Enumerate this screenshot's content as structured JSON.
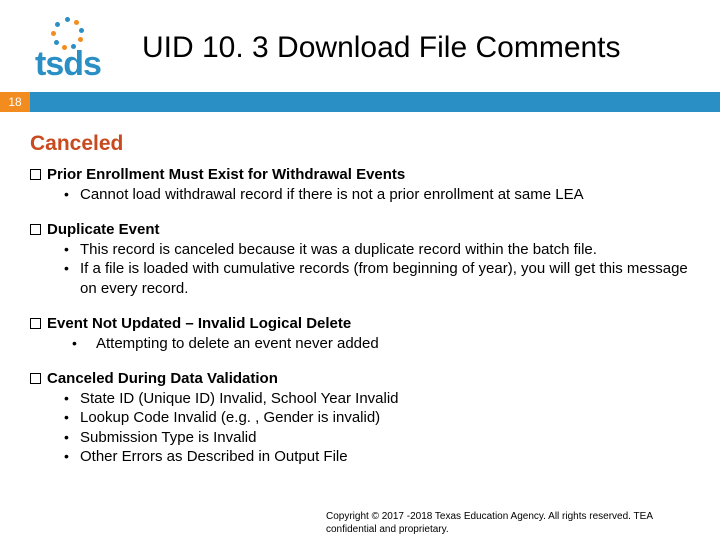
{
  "logo_text": "tsds",
  "title": "UID 10. 3 Download File Comments",
  "slide_number": "18",
  "section_heading": "Canceled",
  "items": [
    {
      "title": "Prior Enrollment Must Exist for Withdrawal Events",
      "bullets": [
        "Cannot load withdrawal record if there is not a prior enrollment at same LEA"
      ]
    },
    {
      "title": "Duplicate Event",
      "bullets": [
        "This record is canceled because it was a duplicate record within the batch file.",
        "If a file is loaded with cumulative records (from beginning of year), you will get this message on every record."
      ]
    },
    {
      "title": "Event Not Updated – Invalid Logical Delete",
      "bullets": [
        "Attempting to delete an event never added"
      ],
      "wide": true
    },
    {
      "title": "Canceled During Data Validation",
      "bullets": [
        "State ID (Unique ID) Invalid, School Year Invalid",
        "Lookup Code Invalid (e.g. , Gender is invalid)",
        "Submission Type is Invalid",
        "Other Errors as Described in Output File"
      ]
    }
  ],
  "footer": "Copyright © 2017 -2018 Texas Education Agency. All rights reserved. TEA confidential and proprietary."
}
